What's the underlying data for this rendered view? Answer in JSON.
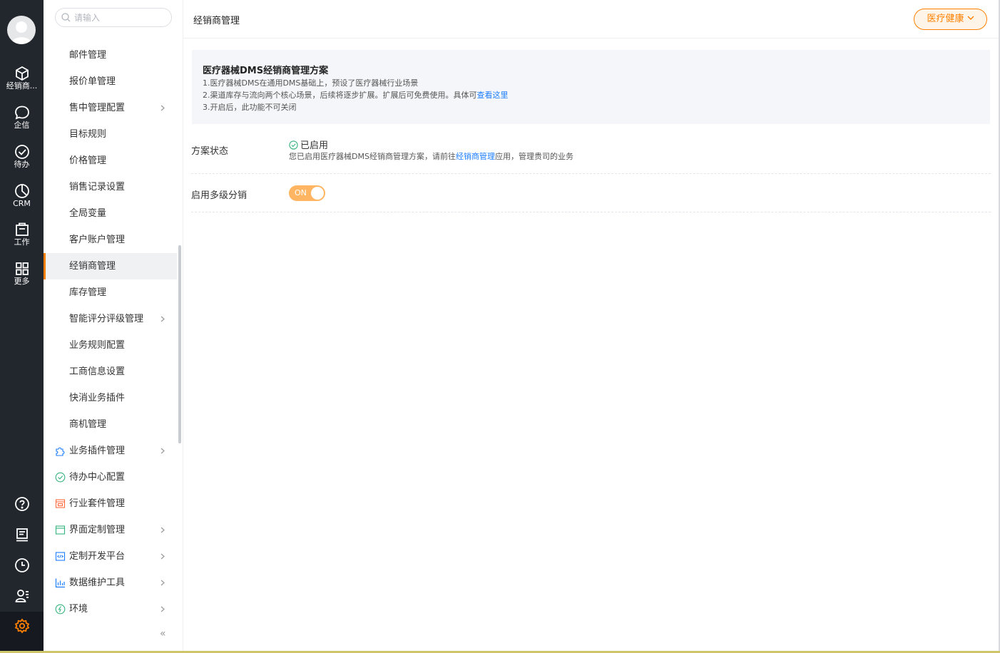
{
  "rail": {
    "items": [
      {
        "icon": "cube-icon",
        "label": "经销商..."
      },
      {
        "icon": "chat-bubble-icon",
        "label": "企信"
      },
      {
        "icon": "check-circle-icon",
        "label": "待办"
      },
      {
        "icon": "clock-pie-icon",
        "label": "CRM"
      },
      {
        "icon": "briefcase-icon",
        "label": "工作"
      },
      {
        "icon": "grid-icon",
        "label": "更多"
      }
    ],
    "bottom": [
      "help-icon",
      "notepad-icon",
      "history-icon",
      "contacts-icon",
      "settings-icon"
    ],
    "accent": "#ff8000"
  },
  "menu": {
    "search_placeholder": "请输入",
    "items": [
      {
        "label": "邮件管理"
      },
      {
        "label": "报价单管理"
      },
      {
        "label": "售中管理配置",
        "chevron": true
      },
      {
        "label": "目标规则"
      },
      {
        "label": "价格管理"
      },
      {
        "label": "销售记录设置"
      },
      {
        "label": "全局变量"
      },
      {
        "label": "客户账户管理"
      },
      {
        "label": "经销商管理",
        "active": true
      },
      {
        "label": "库存管理"
      },
      {
        "label": "智能评分评级管理",
        "chevron": true
      },
      {
        "label": "业务规则配置"
      },
      {
        "label": "工商信息设置"
      },
      {
        "label": "快消业务插件"
      },
      {
        "label": "商机管理"
      },
      {
        "label": "业务插件管理",
        "chevron": true,
        "icon": "puzzle-icon"
      },
      {
        "label": "待办中心配置",
        "icon": "check-circle-icon"
      },
      {
        "label": "行业套件管理",
        "icon": "suite-icon"
      },
      {
        "label": "界面定制管理",
        "chevron": true,
        "icon": "window-icon"
      },
      {
        "label": "定制开发平台",
        "chevron": true,
        "icon": "code-icon"
      },
      {
        "label": "数据维护工具",
        "chevron": true,
        "icon": "bar-chart-icon"
      },
      {
        "label": "环境",
        "chevron": true,
        "icon": "environment-icon"
      }
    ],
    "collapse_glyph": "«"
  },
  "header": {
    "title": "经销商管理",
    "industry_button": "医疗健康"
  },
  "info": {
    "title": "医疗器械DMS经销商管理方案",
    "line1": "1.医疗器械DMS在通用DMS基础上，预设了医疗器械行业场景",
    "line2_prefix": "2.渠道库存与流向两个核心场景，后续将逐步扩展。扩展后可免费使用。具体可",
    "line2_link": "查看这里",
    "line3": "3.开启后，此功能不可关闭"
  },
  "settings": {
    "status_label": "方案状态",
    "status_value": "已启用",
    "status_desc_prefix": "您已启用医疗器械DMS经销商管理方案，请前往",
    "status_desc_link": "经销商管理",
    "status_desc_suffix": "应用，管理贵司的业务",
    "multilevel_label": "启用多级分销",
    "toggle_text": "ON",
    "toggle_state": true
  }
}
